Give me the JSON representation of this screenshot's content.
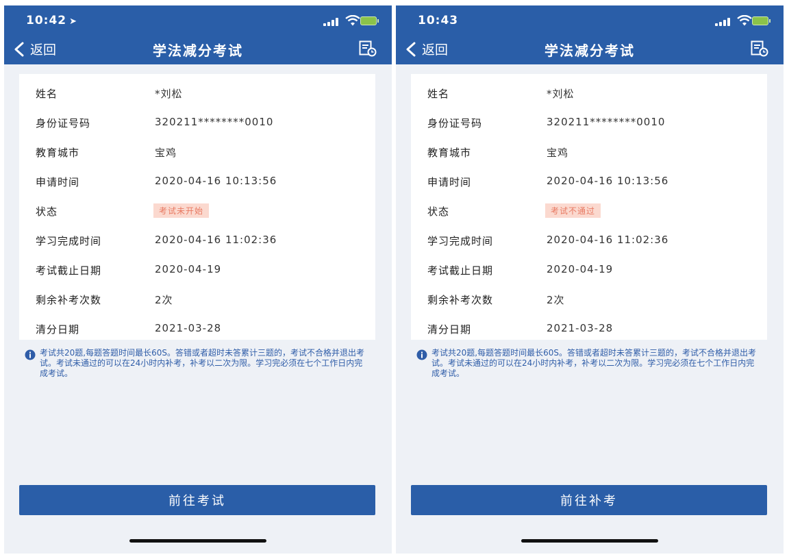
{
  "phones": [
    {
      "status_bar": {
        "time": "10:42",
        "location_arrow": "➤"
      },
      "nav": {
        "back_label": "返回",
        "title": "学法减分考试",
        "right_icon": "document-icon"
      },
      "fields": [
        {
          "label": "姓名",
          "value": "*刘松"
        },
        {
          "label": "身份证号码",
          "value": "320211********0010"
        },
        {
          "label": "教育城市",
          "value": "宝鸡"
        },
        {
          "label": "申请时间",
          "value": "2020-04-16 10:13:56"
        },
        {
          "label": "状态",
          "value": "考试未开始"
        },
        {
          "label": "学习完成时间",
          "value": "2020-04-16 11:02:36"
        },
        {
          "label": "考试截止日期",
          "value": "2020-04-19"
        },
        {
          "label": "剩余补考次数",
          "value": "2次"
        },
        {
          "label": "清分日期",
          "value": "2021-03-28"
        }
      ],
      "notice": "考试共20题,每题答题时间最长60S。答错或者超时未答累计三题的，考试不合格并退出考试。考试未通过的可以在24小时内补考，补考以二次为限。学习完必须在七个工作日内完成考试。",
      "action_label": "前往考试"
    },
    {
      "status_bar": {
        "time": "10:43",
        "location_arrow": ""
      },
      "nav": {
        "back_label": "返回",
        "title": "学法减分考试",
        "right_icon": "document-icon"
      },
      "fields": [
        {
          "label": "姓名",
          "value": "*刘松"
        },
        {
          "label": "身份证号码",
          "value": "320211********0010"
        },
        {
          "label": "教育城市",
          "value": "宝鸡"
        },
        {
          "label": "申请时间",
          "value": "2020-04-16 10:13:56"
        },
        {
          "label": "状态",
          "value": "考试不通过"
        },
        {
          "label": "学习完成时间",
          "value": "2020-04-16 11:02:36"
        },
        {
          "label": "考试截止日期",
          "value": "2020-04-19"
        },
        {
          "label": "剩余补考次数",
          "value": "2次"
        },
        {
          "label": "清分日期",
          "value": "2021-03-28"
        }
      ],
      "notice": "考试共20题,每题答题时间最长60S。答错或者超时未答累计三题的，考试不合格并退出考试。考试未通过的可以在24小时内补考，补考以二次为限。学习完必须在七个工作日内完成考试。",
      "action_label": "前往补考"
    }
  ],
  "colors": {
    "header": "#2a5ea8",
    "background": "#eef1f6",
    "status_badge_text": "#e87a63",
    "status_badge_bg": "#fbd9cf",
    "notice_text": "#2f5da8"
  }
}
